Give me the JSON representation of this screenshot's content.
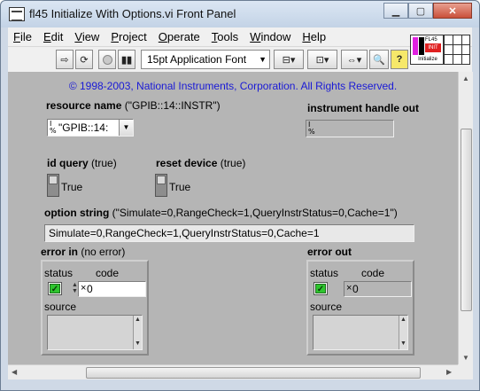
{
  "window": {
    "title": "fl45 Initialize With Options.vi Front Panel",
    "controls": [
      "minimize",
      "maximize",
      "close"
    ]
  },
  "menu": [
    "File",
    "Edit",
    "View",
    "Project",
    "Operate",
    "Tools",
    "Window",
    "Help"
  ],
  "menu_mnemonics": [
    "F",
    "E",
    "V",
    "P",
    "O",
    "T",
    "W",
    "H"
  ],
  "toolbar": {
    "font_select": "15pt Application Font",
    "icons": [
      "run-arrow-icon",
      "run-continuous-icon",
      "abort-icon",
      "pause-icon",
      "align-icon",
      "distribute-icon",
      "resize-icon",
      "search-icon",
      "help-icon"
    ]
  },
  "vi_icon": {
    "lines": [
      "FL45",
      "INIT",
      "Initialize"
    ]
  },
  "panel": {
    "copyright": "© 1998-2003, National Instruments, Corporation.  All Rights Reserved.",
    "resource_name": {
      "label": "resource name",
      "default": "(\"GPIB::14::INSTR\")",
      "value": "\"GPIB::14:"
    },
    "instrument_handle_out": {
      "label": "instrument handle out",
      "value": ""
    },
    "id_query": {
      "label": "id query",
      "default": "(true)",
      "value": "True"
    },
    "reset_device": {
      "label": "reset device",
      "default": "(true)",
      "value": "True"
    },
    "option_string": {
      "label": "option string",
      "default": "(\"Simulate=0,RangeCheck=1,QueryInstrStatus=0,Cache=1\")",
      "value": "Simulate=0,RangeCheck=1,QueryInstrStatus=0,Cache=1"
    },
    "error_in": {
      "label": "error in",
      "default": "(no error)",
      "status_label": "status",
      "code_label": "code",
      "code_value": "0",
      "source_label": "source",
      "status_mark": "✓"
    },
    "error_out": {
      "label": "error out",
      "status_label": "status",
      "code_label": "code",
      "code_value": "0",
      "source_label": "source",
      "status_mark": "✓"
    }
  }
}
